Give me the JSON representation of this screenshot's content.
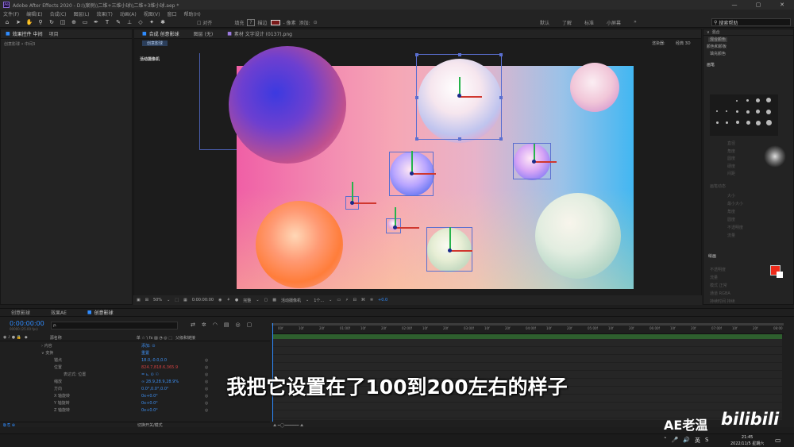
{
  "window": {
    "title": "Adobe After Effects 2020 - D:\\\\案例\\\\二维+三维小球\\\\二维+3维小球.aep *",
    "controls": [
      "—",
      "▢",
      "✕"
    ]
  },
  "menu": [
    "文件(F)",
    "编辑(E)",
    "合成(C)",
    "图层(L)",
    "效果(T)",
    "动画(A)",
    "视图(V)",
    "窗口",
    "帮助(H)"
  ],
  "toolbar": {
    "align_label": "对齐",
    "fill_label": "填充",
    "fill_help": "?",
    "stroke_label": "描边",
    "stroke_px": "- 像素",
    "add_label": "添加:",
    "workspaces": [
      "默认",
      "了解",
      "标准",
      "小屏幕"
    ],
    "search_placeholder": "搜索帮助"
  },
  "left_panel": {
    "tab1": "效果控件 中间",
    "tab2": "项目",
    "subtitle": "创意影球 • 中间3"
  },
  "comp_panel": {
    "tab1": "合成 创意影球",
    "tab2": "图层 (无)",
    "tab3": "素材 文字设计 (0137).png",
    "sub_tab": "创意影球",
    "renderer_label": "渲染器:",
    "renderer_value": "经典 3D",
    "camera_label": "活动摄像机"
  },
  "viewer_bar": {
    "zoom": "50%",
    "timecode": "0:00:00:00",
    "quality": "完整",
    "camera": "活动摄像机",
    "views": "1个...",
    "exposure": "+0.0"
  },
  "right_panel": {
    "title": "画笔",
    "blend_title": "混合",
    "blend_option": "混合颜色",
    "colors_title": "颜色和颜板",
    "fill_option": "填充颜色",
    "brush_section": "画笔",
    "diameter_label": "直径",
    "angle_label": "角度",
    "roundness_label": "圆度",
    "hardness_label": "硬度",
    "spacing_label": "间距",
    "dynamics_label": "画笔动态",
    "size_label": "大小",
    "min_size_label": "最小大小",
    "angle2_label": "角度",
    "roundness2_label": "圆度",
    "opacity_label": "不透明度",
    "flow_label": "流量",
    "paint_title": "绘画",
    "paint_opacity": "不透明度",
    "paint_flow": "流量",
    "mode_label": "模式",
    "mode_value": "正常",
    "channel_label": "通道",
    "channel_value": "RGBA",
    "duration_label": "持续时间",
    "duration_value": "持续"
  },
  "timeline": {
    "tabs": [
      "创意影球",
      "效果AE",
      "创意影球"
    ],
    "timecode": "0:00:00:00",
    "frames": "00000 (25.00 fps)",
    "search_placeholder": "ρ.",
    "header_name": "源名称",
    "header_parent": "父级和链接",
    "ruler": [
      "00f",
      "10f",
      "20f",
      "01:00f",
      "10f",
      "20f",
      "02:00f",
      "10f",
      "20f",
      "03:00f",
      "10f",
      "20f",
      "04:00f",
      "10f",
      "20f",
      "05:00f",
      "10f",
      "20f",
      "06:00f",
      "10f",
      "20f",
      "07:00f",
      "10f",
      "20f",
      "08:00"
    ],
    "rows": [
      {
        "label": "› 内容",
        "value": "添加: ⊙"
      },
      {
        "label": "∨ 变换",
        "value": "重置"
      },
      {
        "label": "锚点",
        "value": "18.0,-0.0,0.0"
      },
      {
        "label": "位置",
        "value": "824.7,818.6,365.9",
        "red": true
      },
      {
        "label": "表达式: 位置",
        "value": "= ⊾ ⊙ ☉"
      },
      {
        "label": "缩放",
        "value": "∞ 28.9,28.9,28.9%"
      },
      {
        "label": "方向",
        "value": "0.0°,0.0°,0.0°"
      },
      {
        "label": "X 轴旋转",
        "value": "0x+0.0°"
      },
      {
        "label": "Y 轴旋转",
        "value": "0x+0.0°"
      },
      {
        "label": "Z 轴旋转",
        "value": "0x+0.0°"
      }
    ],
    "bottom_label": "切换开关/模式"
  },
  "subtitle": "我把它设置在了100到200左右的样子",
  "watermark": "AE老温",
  "bilibili": "bilibili",
  "taskbar": {
    "time": "21:45",
    "date": "2022/11/5 星期六",
    "ime": "英"
  }
}
